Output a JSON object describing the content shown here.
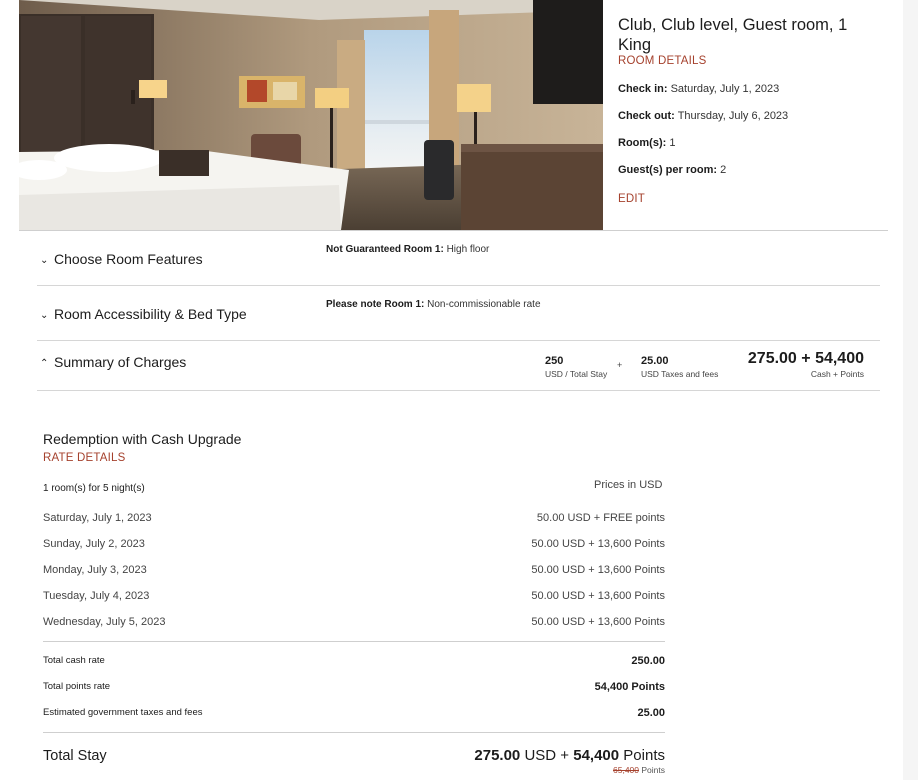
{
  "room": {
    "title": "Club, Club level, Guest room, 1 King",
    "details_link": "ROOM DETAILS",
    "check_in_label": "Check in:",
    "check_in_value": "Saturday, July 1, 2023",
    "check_out_label": "Check out:",
    "check_out_value": "Thursday, July 6, 2023",
    "rooms_label": "Room(s):",
    "rooms_value": "1",
    "guests_label": "Guest(s) per room:",
    "guests_value": "2",
    "edit_link": "EDIT"
  },
  "accordions": [
    {
      "title": "Choose Room Features",
      "icon": "chevron-down-icon",
      "note_label": "Not Guaranteed Room 1:",
      "note_value": "High floor"
    },
    {
      "title": "Room Accessibility & Bed Type",
      "icon": "chevron-down-icon",
      "note_label": "Please note Room 1:",
      "note_value": "Non-commissionable rate"
    }
  ],
  "summary": {
    "title": "Summary of Charges",
    "icon": "chevron-up-icon",
    "stay_amount": "250",
    "stay_label": "USD / Total Stay",
    "plus": "+",
    "taxes_amount": "25.00",
    "taxes_label": "USD Taxes and fees",
    "total": "275.00 + 54,400",
    "total_label": "Cash + Points"
  },
  "rate": {
    "title": "Redemption with Cash Upgrade",
    "details_link": "RATE DETAILS",
    "rooms_nights": "1 room(s) for 5 night(s)",
    "prices_in": "Prices in USD",
    "nights": [
      {
        "date": "Saturday, July 1, 2023",
        "price": "50.00 USD + FREE points"
      },
      {
        "date": "Sunday, July 2, 2023",
        "price": "50.00 USD + 13,600 Points"
      },
      {
        "date": "Monday, July 3, 2023",
        "price": "50.00 USD + 13,600 Points"
      },
      {
        "date": "Tuesday, July 4, 2023",
        "price": "50.00 USD + 13,600 Points"
      },
      {
        "date": "Wednesday, July 5, 2023",
        "price": "50.00 USD + 13,600 Points"
      }
    ],
    "totals": [
      {
        "label": "Total cash rate",
        "value": "250.00"
      },
      {
        "label": "Total points rate",
        "value": "54,400 Points"
      },
      {
        "label": "Estimated government taxes and fees",
        "value": "25.00"
      }
    ],
    "total_stay_label": "Total Stay",
    "total_stay_cash": "275.00",
    "total_stay_usd": "USD +",
    "total_stay_points": "54,400",
    "total_stay_points_label": "Points",
    "original_points": "65,400",
    "original_points_label": "Points"
  },
  "colors": {
    "accent": "#a5412d",
    "text": "#1c1c1c",
    "rule": "#cfcfcf"
  }
}
